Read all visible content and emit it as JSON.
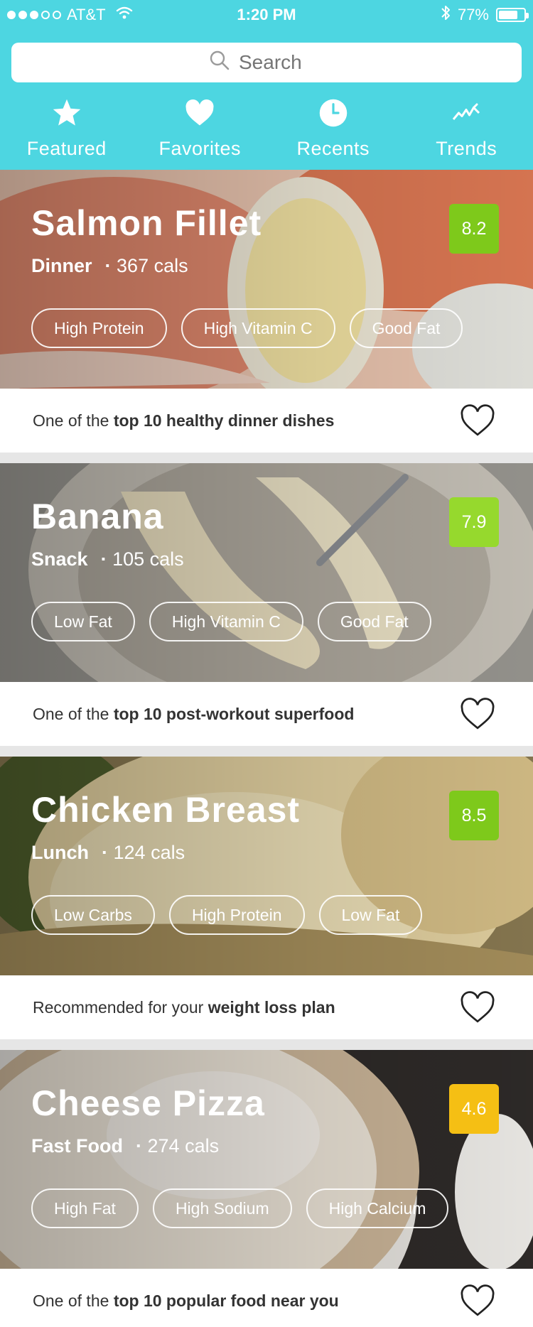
{
  "status_bar": {
    "carrier": "AT&T",
    "time": "1:20 PM",
    "battery": "77%",
    "battery_level": 0.77,
    "signal_bars_filled": 3,
    "signal_bars_total": 5
  },
  "search": {
    "placeholder": "Search"
  },
  "tabs": [
    {
      "label": "Featured",
      "icon": "star-icon"
    },
    {
      "label": "Favorites",
      "icon": "heart-icon"
    },
    {
      "label": "Recents",
      "icon": "clock-icon"
    },
    {
      "label": "Trends",
      "icon": "trend-icon"
    }
  ],
  "colors": {
    "header": "#4dd6e1",
    "score_green_dark": "#7ec91b",
    "score_green_light": "#96d92d",
    "score_yellow": "#f5bf14"
  },
  "cards": [
    {
      "title": "Salmon Fillet",
      "meal": "Dinner",
      "sep": "·",
      "cals": "367 cals",
      "score": "8.2",
      "score_color": "#7ec91b",
      "tags": [
        "High Protein",
        "High Vitamin C",
        "Good Fat"
      ],
      "footer_prefix": "One of the ",
      "footer_bold": "top 10 healthy dinner dishes",
      "image_palette": [
        "#e8937b",
        "#f2b49c",
        "#d9e1d8"
      ]
    },
    {
      "title": "Banana",
      "meal": "Snack",
      "sep": "·",
      "cals": "105 cals",
      "score": "7.9",
      "score_color": "#96d92d",
      "tags": [
        "Low Fat",
        "High Vitamin C",
        "Good Fat"
      ],
      "footer_prefix": "One of the ",
      "footer_bold": "top 10 post-workout superfood",
      "image_palette": [
        "#b9b2a6",
        "#e9dfc6",
        "#8b8a86"
      ]
    },
    {
      "title": "Chicken Breast",
      "meal": "Lunch",
      "sep": "·",
      "cals": "124 cals",
      "score": "8.5",
      "score_color": "#7ec91b",
      "tags": [
        "Low Carbs",
        "High Protein",
        "Low Fat"
      ],
      "footer_prefix": "Recommended for your ",
      "footer_bold": "weight loss plan",
      "image_palette": [
        "#b8a170",
        "#ead8a7",
        "#5f6d3a"
      ]
    },
    {
      "title": "Cheese Pizza",
      "meal": "Fast Food",
      "sep": "·",
      "cals": "274 cals",
      "score": "4.6",
      "score_color": "#f5bf14",
      "tags": [
        "High Fat",
        "High Sodium",
        "High Calcium"
      ],
      "footer_prefix": "One of the ",
      "footer_bold": "top 10 popular food near you",
      "image_palette": [
        "#d8c8ae",
        "#f1ece6",
        "#3a3532"
      ]
    }
  ]
}
